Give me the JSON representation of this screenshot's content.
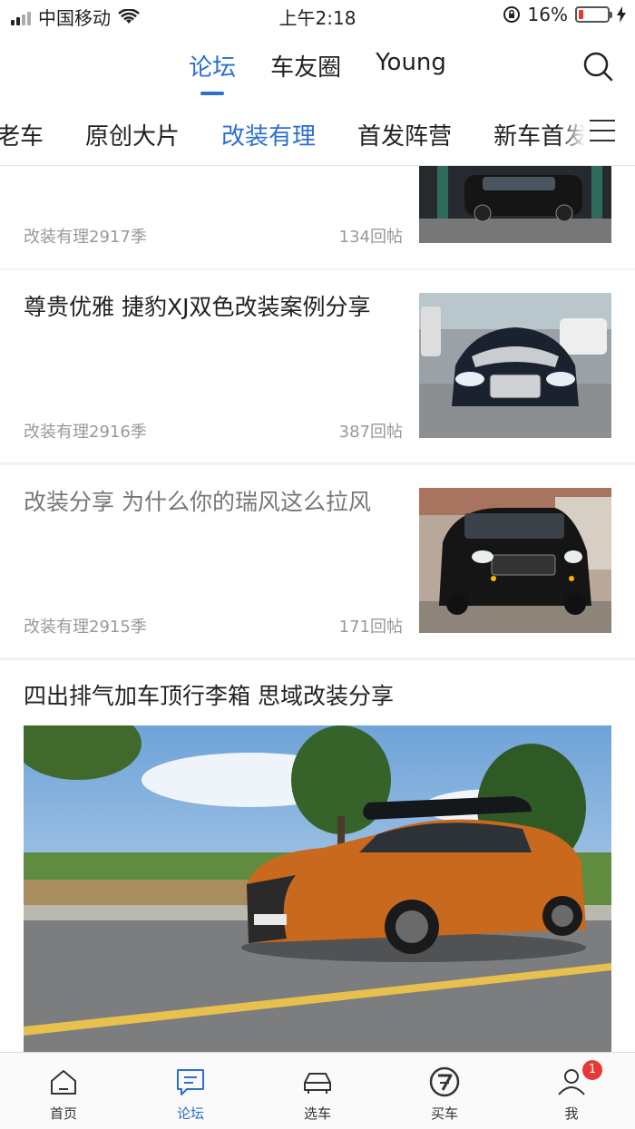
{
  "status_bar": {
    "carrier": "中国移动",
    "time": "上午2:18",
    "battery": "16%",
    "battery_level": 0.16
  },
  "top_tabs": [
    {
      "label": "论坛",
      "active": true
    },
    {
      "label": "车友圈",
      "active": false
    },
    {
      "label": "Young",
      "active": false
    }
  ],
  "categories": [
    {
      "label": "好老车",
      "active": false
    },
    {
      "label": "原创大片",
      "active": false
    },
    {
      "label": "改装有理",
      "active": true
    },
    {
      "label": "首发阵营",
      "active": false
    },
    {
      "label": "新车首发",
      "active": false
    }
  ],
  "posts": [
    {
      "title": "",
      "column": "改装有理2917季",
      "replies": "134回帖"
    },
    {
      "title": "尊贵优雅 捷豹XJ双色改装案例分享",
      "column": "改装有理2916季",
      "replies": "387回帖"
    },
    {
      "title": "改装分享 为什么你的瑞风这么拉风",
      "column": "改装有理2915季",
      "replies": "171回帖"
    },
    {
      "title": "四出排气加车顶行李箱 思域改装分享"
    }
  ],
  "bottom_tabs": [
    {
      "label": "首页",
      "icon": "home-icon"
    },
    {
      "label": "论坛",
      "icon": "forum-icon",
      "active": true
    },
    {
      "label": "选车",
      "icon": "car-select-icon"
    },
    {
      "label": "买车",
      "icon": "buy-car-icon"
    },
    {
      "label": "我",
      "icon": "user-icon",
      "badge": "1"
    }
  ],
  "colors": {
    "accent": "#2c6fd1",
    "badge": "#e53935",
    "car_orange": "#c8691e"
  }
}
